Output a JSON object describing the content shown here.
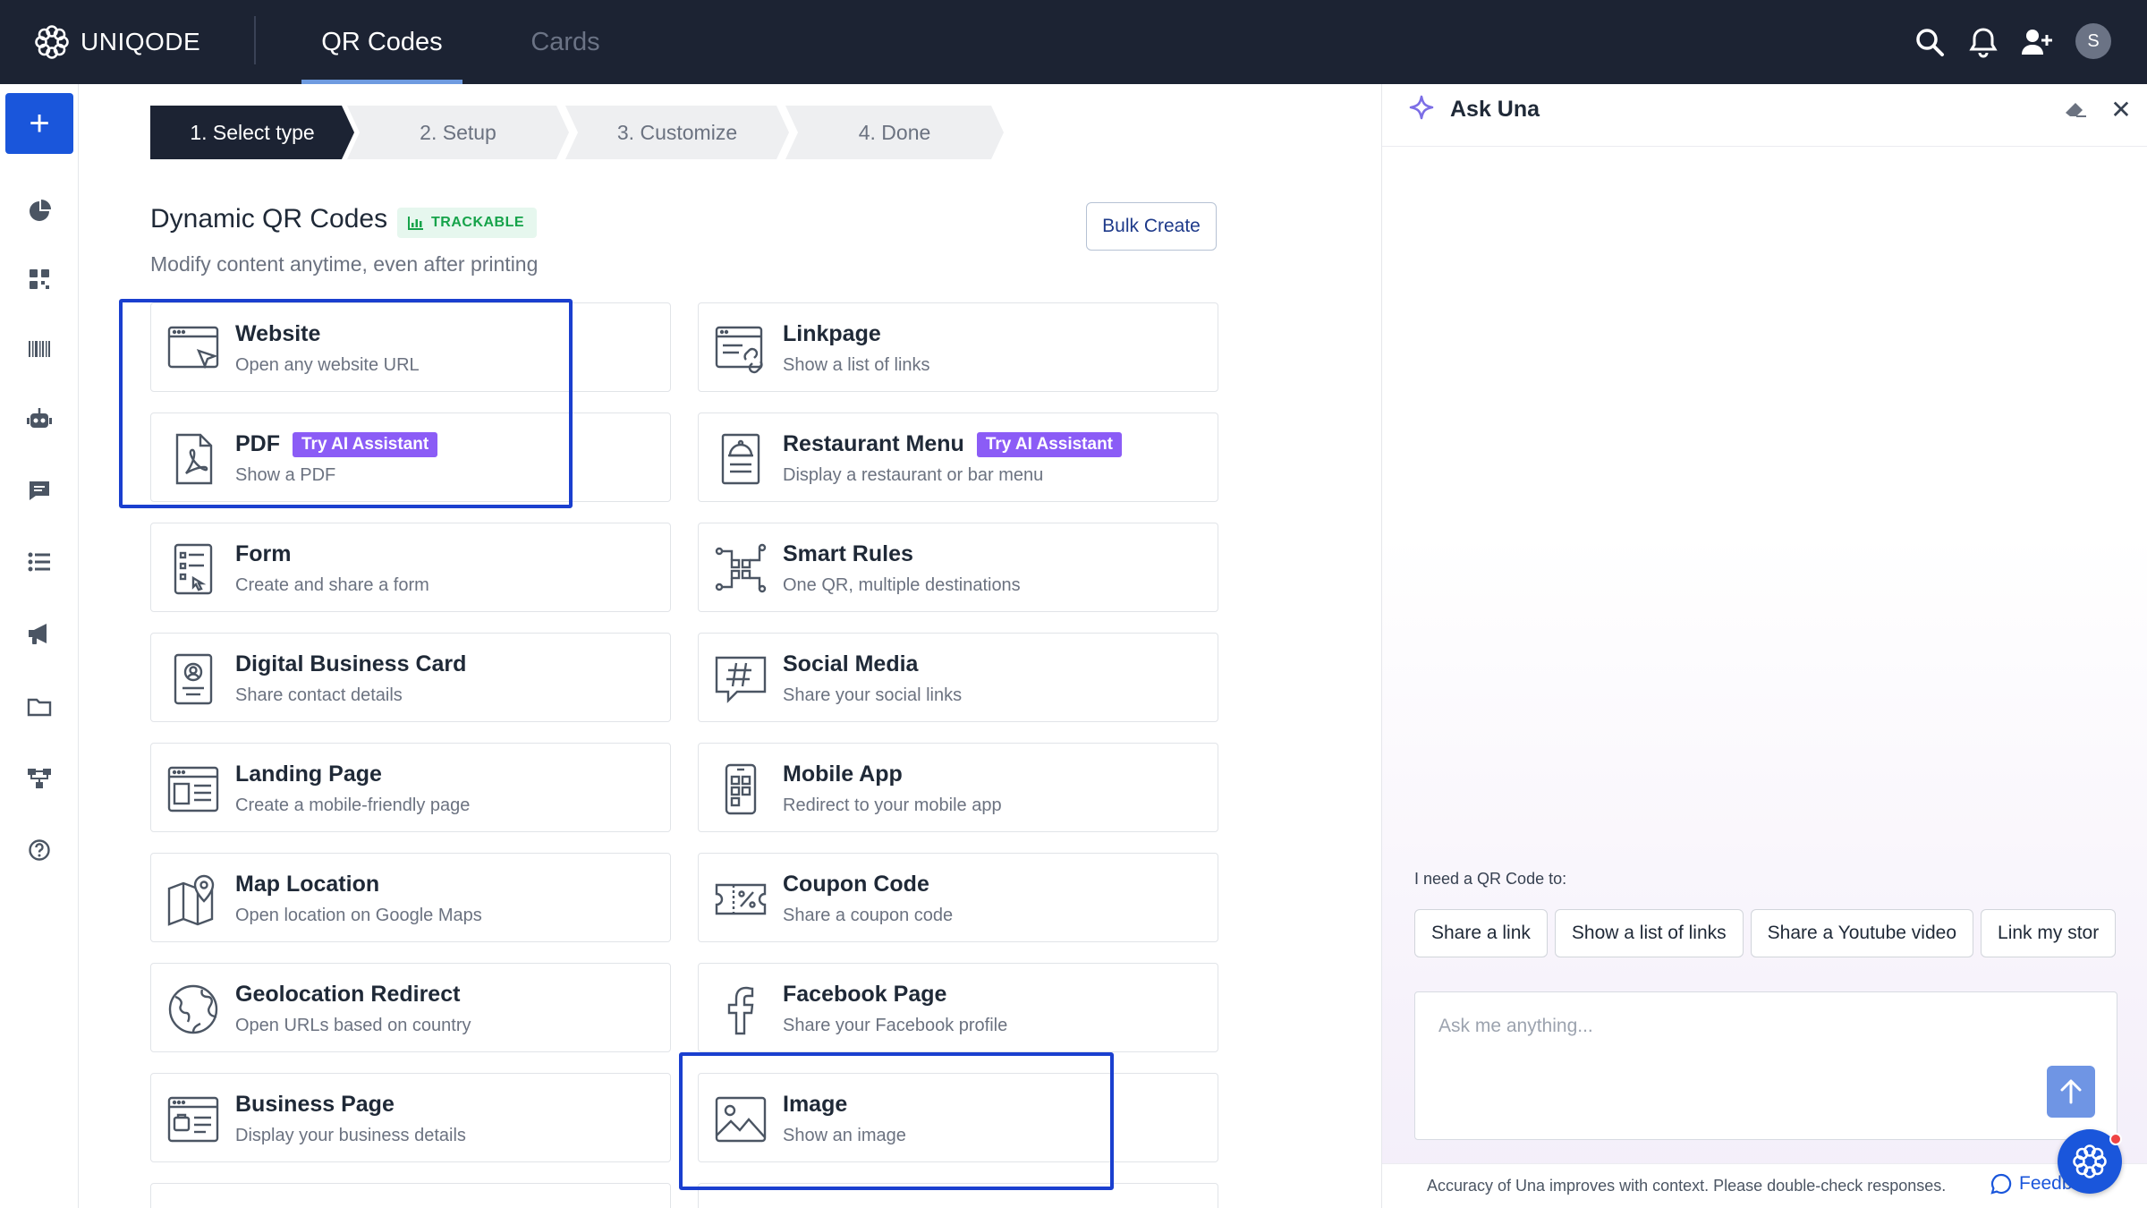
{
  "topbar": {
    "brand": "UNIQODE",
    "tabs": [
      {
        "label": "QR Codes",
        "active": true
      },
      {
        "label": "Cards",
        "active": false
      }
    ],
    "avatar_initial": "S",
    "icons": [
      "search-icon",
      "bell-icon",
      "add-user-icon"
    ]
  },
  "rail": {
    "add_label": "+",
    "icons": [
      "pie-chart-icon",
      "qr-grid-icon",
      "barcode-icon",
      "robot-icon",
      "chat-icon",
      "list-icon",
      "megaphone-icon",
      "folder-icon",
      "workflow-icon",
      "help-icon"
    ]
  },
  "stepper": {
    "steps": [
      "1. Select type",
      "2. Setup",
      "3. Customize",
      "4. Done"
    ],
    "active_index": 0
  },
  "section": {
    "title": "Dynamic QR Codes",
    "badge": "TRACKABLE",
    "subtitle": "Modify content anytime, even after printing",
    "bulk_button": "Bulk Create"
  },
  "cards": [
    {
      "title": "Website",
      "desc": "Open any website URL",
      "icon": "website-icon"
    },
    {
      "title": "Linkpage",
      "desc": "Show a list of links",
      "icon": "linkpage-icon"
    },
    {
      "title": "PDF",
      "desc": "Show a PDF",
      "badge": "Try AI Assistant",
      "icon": "pdf-icon"
    },
    {
      "title": "Restaurant Menu",
      "desc": "Display a restaurant or bar menu",
      "badge": "Try AI Assistant",
      "icon": "restaurant-menu-icon"
    },
    {
      "title": "Form",
      "desc": "Create and share a form",
      "icon": "form-icon"
    },
    {
      "title": "Smart Rules",
      "desc": "One QR, multiple destinations",
      "icon": "smart-rules-icon"
    },
    {
      "title": "Digital Business Card",
      "desc": "Share contact details",
      "icon": "business-card-icon"
    },
    {
      "title": "Social Media",
      "desc": "Share your social links",
      "icon": "hashtag-icon"
    },
    {
      "title": "Landing Page",
      "desc": "Create a mobile-friendly page",
      "icon": "landing-page-icon"
    },
    {
      "title": "Mobile App",
      "desc": "Redirect to your mobile app",
      "icon": "mobile-app-icon"
    },
    {
      "title": "Map Location",
      "desc": "Open location on Google Maps",
      "icon": "map-location-icon"
    },
    {
      "title": "Coupon Code",
      "desc": "Share a coupon code",
      "icon": "coupon-icon"
    },
    {
      "title": "Geolocation Redirect",
      "desc": "Open URLs based on country",
      "icon": "globe-icon"
    },
    {
      "title": "Facebook Page",
      "desc": "Share your Facebook profile",
      "icon": "facebook-icon"
    },
    {
      "title": "Business Page",
      "desc": "Display your business details",
      "icon": "business-page-icon"
    },
    {
      "title": "Image",
      "desc": "Show an image",
      "icon": "image-icon"
    }
  ],
  "assistant": {
    "title": "Ask Una",
    "prompt_label": "I need a QR Code to:",
    "chips": [
      "Share a link",
      "Show a list of links",
      "Share a Youtube video",
      "Link my stor"
    ],
    "input_placeholder": "Ask me anything...",
    "disclaimer": "Accuracy of Una improves with context. Please double-check responses.",
    "feedback": "Feedback"
  },
  "colors": {
    "topbar": "#1c2333",
    "accent": "#1a56db",
    "ai_badge": "#8b5cf6",
    "trackable": "#16a34a",
    "highlight": "#1a3fcf"
  }
}
